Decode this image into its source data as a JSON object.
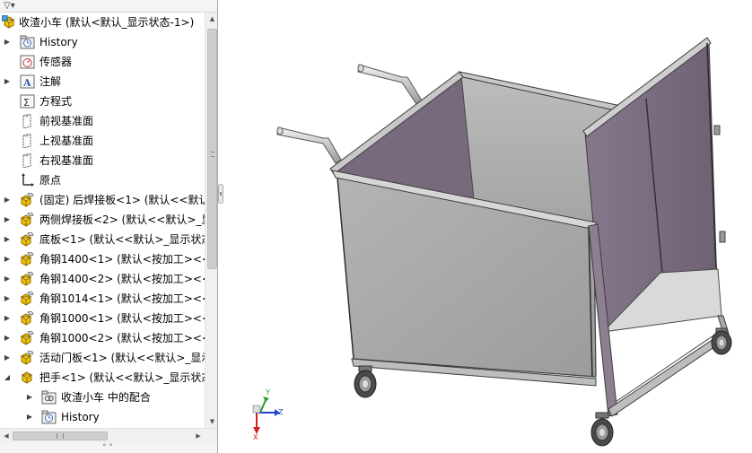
{
  "feature_tree": {
    "filter_icon": "funnel-icon",
    "rows": [
      {
        "label": "收渣小车  (默认<默认_显示状态-1>)",
        "icon": "assembly-icon",
        "expander": "expanded",
        "level": 0
      },
      {
        "label": "History",
        "icon": "history-folder-icon",
        "expander": "collapsed",
        "level": 1
      },
      {
        "label": "传感器",
        "icon": "sensor-icon",
        "expander": "none",
        "level": 1
      },
      {
        "label": "注解",
        "icon": "annotation-icon",
        "expander": "collapsed",
        "level": 1
      },
      {
        "label": "方程式",
        "icon": "equation-icon",
        "expander": "none",
        "level": 1
      },
      {
        "label": "前视基准面",
        "icon": "plane-icon",
        "expander": "none",
        "level": 1
      },
      {
        "label": "上视基准面",
        "icon": "plane-icon",
        "expander": "none",
        "level": 1
      },
      {
        "label": "右视基准面",
        "icon": "plane-icon",
        "expander": "none",
        "level": 1
      },
      {
        "label": "原点",
        "icon": "origin-icon",
        "expander": "none",
        "level": 1
      },
      {
        "label": "(固定) 后焊接板<1> (默认<<默认",
        "icon": "part-icon",
        "expander": "collapsed",
        "level": 1
      },
      {
        "label": "两侧焊接板<2> (默认<<默认>_显",
        "icon": "part-icon",
        "expander": "collapsed",
        "level": 1
      },
      {
        "label": "底板<1> (默认<<默认>_显示状态",
        "icon": "part-icon",
        "expander": "collapsed",
        "level": 1
      },
      {
        "label": "角钢1400<1> (默认<按加工><<",
        "icon": "part-icon",
        "expander": "collapsed",
        "level": 1
      },
      {
        "label": "角钢1400<2> (默认<按加工><<",
        "icon": "part-icon",
        "expander": "collapsed",
        "level": 1
      },
      {
        "label": "角钢1014<1> (默认<按加工><<",
        "icon": "part-icon",
        "expander": "collapsed",
        "level": 1
      },
      {
        "label": "角钢1000<1> (默认<按加工><<",
        "icon": "part-icon",
        "expander": "collapsed",
        "level": 1
      },
      {
        "label": "角钢1000<2> (默认<按加工><<",
        "icon": "part-icon",
        "expander": "collapsed",
        "level": 1
      },
      {
        "label": "活动门板<1> (默认<<默认>_显示",
        "icon": "part-icon",
        "expander": "collapsed",
        "level": 1
      },
      {
        "label": "把手<1> (默认<<默认>_显示状态",
        "icon": "subassembly-icon",
        "expander": "expanded",
        "level": 1
      },
      {
        "label": "收渣小车 中的配合",
        "icon": "mates-folder-icon",
        "expander": "collapsed",
        "level": 2
      },
      {
        "label": "History",
        "icon": "history-folder-icon",
        "expander": "collapsed",
        "level": 2
      }
    ]
  },
  "scrollbars": {
    "horizontal_grip": "III",
    "vertical_grip": "≡"
  },
  "bottom_strip": {
    "dots": "° °"
  },
  "triad": {
    "x_label": "X",
    "y_label": "Y",
    "z_label": "Z"
  },
  "colors": {
    "panel_purple": "#7d6e82",
    "panel_grey": "#a9a9a9",
    "triad_x": "#d22020",
    "triad_y": "#2a9a2a",
    "triad_z": "#2040d0"
  }
}
